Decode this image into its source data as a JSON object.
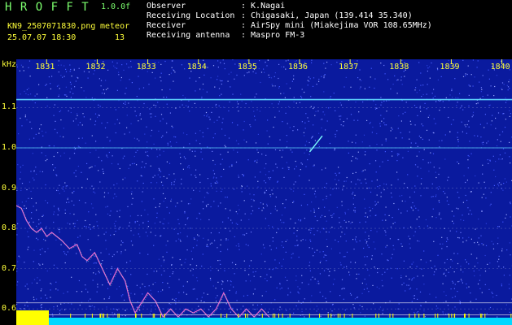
{
  "header": {
    "app_name": "H R O F F T",
    "version": "1.0.0f",
    "filename": "KN9_2507071830.png",
    "station_label": "meteor",
    "timestamp": "25.07.07 18:30",
    "count": "13",
    "info": [
      {
        "key": "Observer",
        "value": ": K.Nagai"
      },
      {
        "key": "Receiving Location",
        "value": ": Chigasaki, Japan (139.414 35.340)"
      },
      {
        "key": "Receiver",
        "value": ": AirSpy mini (Miakejima VOR 108.65MHz)"
      },
      {
        "key": "Receiving antenna",
        "value": ": Maspro FM-3"
      }
    ]
  },
  "chart_data": {
    "type": "heatmap",
    "ylabel": "kHz",
    "x_ticks": [
      "1831",
      "1832",
      "1833",
      "1834",
      "1835",
      "1836",
      "1837",
      "1838",
      "1839",
      "1840"
    ],
    "y_ticks": [
      "1.1",
      "1.0",
      "0.9",
      "0.8",
      "0.7",
      "0.6"
    ],
    "ylim": [
      0.56,
      1.22
    ],
    "carriers_khz": [
      1.12,
      1.0
    ],
    "meteor_echo": {
      "time": 1836.2,
      "khz_start": 0.99,
      "khz_end": 1.03
    },
    "noise_trace": [
      {
        "t": 1830.35,
        "v": 0.86
      },
      {
        "t": 1830.5,
        "v": 0.85
      },
      {
        "t": 1830.6,
        "v": 0.82
      },
      {
        "t": 1830.7,
        "v": 0.8
      },
      {
        "t": 1830.8,
        "v": 0.79
      },
      {
        "t": 1830.9,
        "v": 0.8
      },
      {
        "t": 1831.0,
        "v": 0.78
      },
      {
        "t": 1831.1,
        "v": 0.79
      },
      {
        "t": 1831.2,
        "v": 0.78
      },
      {
        "t": 1831.3,
        "v": 0.77
      },
      {
        "t": 1831.45,
        "v": 0.75
      },
      {
        "t": 1831.6,
        "v": 0.76
      },
      {
        "t": 1831.7,
        "v": 0.73
      },
      {
        "t": 1831.8,
        "v": 0.72
      },
      {
        "t": 1831.95,
        "v": 0.74
      },
      {
        "t": 1832.1,
        "v": 0.7
      },
      {
        "t": 1832.25,
        "v": 0.66
      },
      {
        "t": 1832.4,
        "v": 0.7
      },
      {
        "t": 1832.55,
        "v": 0.67
      },
      {
        "t": 1832.65,
        "v": 0.62
      },
      {
        "t": 1832.75,
        "v": 0.59
      },
      {
        "t": 1832.85,
        "v": 0.61
      },
      {
        "t": 1833.0,
        "v": 0.64
      },
      {
        "t": 1833.15,
        "v": 0.62
      },
      {
        "t": 1833.3,
        "v": 0.58
      },
      {
        "t": 1833.45,
        "v": 0.6
      },
      {
        "t": 1833.6,
        "v": 0.58
      },
      {
        "t": 1833.75,
        "v": 0.6
      },
      {
        "t": 1833.9,
        "v": 0.59
      },
      {
        "t": 1834.05,
        "v": 0.6
      },
      {
        "t": 1834.2,
        "v": 0.58
      },
      {
        "t": 1834.35,
        "v": 0.6
      },
      {
        "t": 1834.5,
        "v": 0.64
      },
      {
        "t": 1834.65,
        "v": 0.6
      },
      {
        "t": 1834.8,
        "v": 0.58
      },
      {
        "t": 1834.95,
        "v": 0.6
      },
      {
        "t": 1835.1,
        "v": 0.58
      },
      {
        "t": 1835.25,
        "v": 0.6
      },
      {
        "t": 1835.4,
        "v": 0.58
      }
    ]
  },
  "colors": {
    "background": "#0a1a9e",
    "carrier": "#5fd7ff",
    "gridline": "#8f9ad8",
    "floor": "#00d8ff",
    "marker": "#ffff00"
  }
}
